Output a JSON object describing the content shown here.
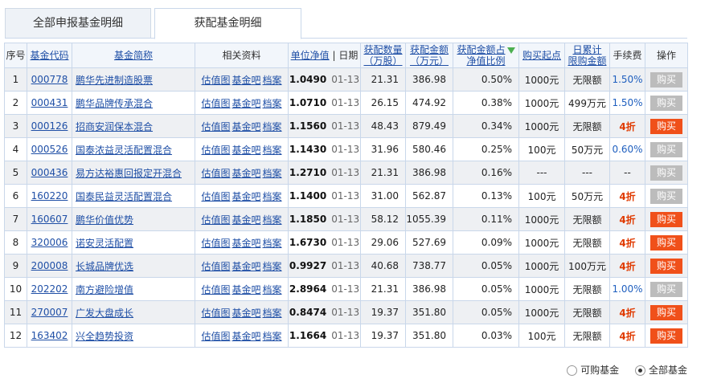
{
  "tabs": [
    "全部申报基金明细",
    "获配基金明细"
  ],
  "headers": {
    "seq": "序号",
    "code": "基金代码",
    "name": "基金简称",
    "related": "相关资料",
    "nav": "单位净值",
    "date": "日期",
    "qty_1": "获配数量",
    "qty_2": "（万股）",
    "amt_1": "获配金额",
    "amt_2": "（万元）",
    "ratio_1": "获配金额占",
    "ratio_2": "净值比例",
    "min_buy": "购买起点",
    "daily_1": "日累计",
    "daily_2": "限购金额",
    "fee": "手续费",
    "action": "操作"
  },
  "rows": [
    {
      "seq": "1",
      "code": "000778",
      "name": "鹏华先进制造股票",
      "r1": "估值图",
      "r2": "基金吧",
      "r3": "档案",
      "nav": "1.0490",
      "date": "01-13",
      "qty": "21.31",
      "amt": "386.98",
      "ratio": "0.50%",
      "min": "1000元",
      "daily": "无限额",
      "fee": "1.50%",
      "fee_type": "rate",
      "btn": "购买",
      "active": false
    },
    {
      "seq": "2",
      "code": "000431",
      "name": "鹏华品牌传承混合",
      "r1": "估值图",
      "r2": "基金吧",
      "r3": "档案",
      "nav": "1.0710",
      "date": "01-13",
      "qty": "26.15",
      "amt": "474.92",
      "ratio": "0.38%",
      "min": "1000元",
      "daily": "499万元",
      "fee": "1.50%",
      "fee_type": "rate",
      "btn": "购买",
      "active": false
    },
    {
      "seq": "3",
      "code": "000126",
      "name": "招商安润保本混合",
      "r1": "估值图",
      "r2": "基金吧",
      "r3": "档案",
      "nav": "1.1560",
      "date": "01-13",
      "qty": "48.43",
      "amt": "879.49",
      "ratio": "0.34%",
      "min": "1000元",
      "daily": "无限额",
      "fee": "4折",
      "fee_type": "disc",
      "btn": "购买",
      "active": true
    },
    {
      "seq": "4",
      "code": "000526",
      "name": "国泰浓益灵活配置混合",
      "r1": "估值图",
      "r2": "基金吧",
      "r3": "档案",
      "nav": "1.1430",
      "date": "01-13",
      "qty": "31.96",
      "amt": "580.46",
      "ratio": "0.25%",
      "min": "100元",
      "daily": "50万元",
      "fee": "0.60%",
      "fee_type": "rate",
      "btn": "购买",
      "active": false
    },
    {
      "seq": "5",
      "code": "000436",
      "name": "易方达裕惠回报定开混合",
      "r1": "估值图",
      "r2": "基金吧",
      "r3": "档案",
      "nav": "1.2710",
      "date": "01-13",
      "qty": "21.31",
      "amt": "386.98",
      "ratio": "0.16%",
      "min": "---",
      "daily": "---",
      "fee": "--",
      "fee_type": "none",
      "btn": "购买",
      "active": false
    },
    {
      "seq": "6",
      "code": "160220",
      "name": "国泰民益灵活配置混合",
      "r1": "估值图",
      "r2": "基金吧",
      "r3": "档案",
      "nav": "1.1400",
      "date": "01-13",
      "qty": "31.00",
      "amt": "562.87",
      "ratio": "0.13%",
      "min": "100元",
      "daily": "50万元",
      "fee": "4折",
      "fee_type": "disc",
      "btn": "购买",
      "active": false
    },
    {
      "seq": "7",
      "code": "160607",
      "name": "鹏华价值优势",
      "r1": "估值图",
      "r2": "基金吧",
      "r3": "档案",
      "nav": "1.1850",
      "date": "01-13",
      "qty": "58.12",
      "amt": "1055.39",
      "ratio": "0.11%",
      "min": "1000元",
      "daily": "无限额",
      "fee": "4折",
      "fee_type": "disc",
      "btn": "购买",
      "active": true
    },
    {
      "seq": "8",
      "code": "320006",
      "name": "诺安灵活配置",
      "r1": "估值图",
      "r2": "基金吧",
      "r3": "档案",
      "nav": "1.6730",
      "date": "01-13",
      "qty": "29.06",
      "amt": "527.69",
      "ratio": "0.09%",
      "min": "1000元",
      "daily": "无限额",
      "fee": "4折",
      "fee_type": "disc",
      "btn": "购买",
      "active": true
    },
    {
      "seq": "9",
      "code": "200008",
      "name": "长城品牌优选",
      "r1": "估值图",
      "r2": "基金吧",
      "r3": "档案",
      "nav": "0.9927",
      "date": "01-13",
      "qty": "40.68",
      "amt": "738.77",
      "ratio": "0.05%",
      "min": "1000元",
      "daily": "100万元",
      "fee": "4折",
      "fee_type": "disc",
      "btn": "购买",
      "active": true
    },
    {
      "seq": "10",
      "code": "202202",
      "name": "南方避险增值",
      "r1": "估值图",
      "r2": "基金吧",
      "r3": "档案",
      "nav": "2.8964",
      "date": "01-13",
      "qty": "21.31",
      "amt": "386.98",
      "ratio": "0.05%",
      "min": "1000元",
      "daily": "无限额",
      "fee": "1.00%",
      "fee_type": "rate",
      "btn": "购买",
      "active": false
    },
    {
      "seq": "11",
      "code": "270007",
      "name": "广发大盘成长",
      "r1": "估值图",
      "r2": "基金吧",
      "r3": "档案",
      "nav": "0.8474",
      "date": "01-13",
      "qty": "19.37",
      "amt": "351.80",
      "ratio": "0.05%",
      "min": "1000元",
      "daily": "无限额",
      "fee": "4折",
      "fee_type": "disc",
      "btn": "购买",
      "active": true
    },
    {
      "seq": "12",
      "code": "163402",
      "name": "兴全趋势投资",
      "r1": "估值图",
      "r2": "基金吧",
      "r3": "档案",
      "nav": "1.1664",
      "date": "01-13",
      "qty": "19.37",
      "amt": "351.80",
      "ratio": "0.03%",
      "min": "100元",
      "daily": "无限额",
      "fee": "4折",
      "fee_type": "disc",
      "btn": "购买",
      "active": true
    }
  ],
  "footer": {
    "opt_buyable": "可购基金",
    "opt_all": "全部基金",
    "selected": "全部基金"
  },
  "colors": {
    "buy_active": "#f0501a",
    "buy_disabled": "#bcbcbc",
    "link": "#1f4fa6"
  }
}
